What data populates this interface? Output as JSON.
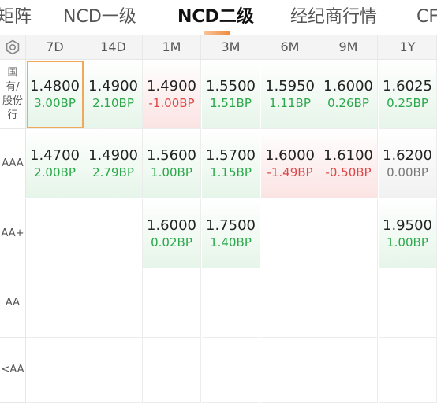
{
  "tabs": [
    {
      "label": "矩阵"
    },
    {
      "label": "NCD一级"
    },
    {
      "label": "NCD二级"
    },
    {
      "label": "经纪商行情"
    },
    {
      "label": "CF"
    }
  ],
  "columns": [
    "7D",
    "14D",
    "1M",
    "3M",
    "6M",
    "9M",
    "1Y"
  ],
  "rows": [
    {
      "label_lines": [
        "国",
        "有/",
        "股份",
        "行"
      ],
      "cells": [
        {
          "rate": "1.4800",
          "bp": "3.00BP",
          "trend": "up",
          "selected": true
        },
        {
          "rate": "1.4900",
          "bp": "2.10BP",
          "trend": "up"
        },
        {
          "rate": "1.4900",
          "bp": "-1.00BP",
          "trend": "down"
        },
        {
          "rate": "1.5500",
          "bp": "1.51BP",
          "trend": "up"
        },
        {
          "rate": "1.5950",
          "bp": "1.11BP",
          "trend": "up"
        },
        {
          "rate": "1.6000",
          "bp": "0.26BP",
          "trend": "up"
        },
        {
          "rate": "1.6025",
          "bp": "0.25BP",
          "trend": "up"
        }
      ]
    },
    {
      "label_lines": [
        "AAA"
      ],
      "cells": [
        {
          "rate": "1.4700",
          "bp": "2.00BP",
          "trend": "up"
        },
        {
          "rate": "1.4900",
          "bp": "2.79BP",
          "trend": "up"
        },
        {
          "rate": "1.5600",
          "bp": "1.00BP",
          "trend": "up"
        },
        {
          "rate": "1.5700",
          "bp": "1.15BP",
          "trend": "up"
        },
        {
          "rate": "1.6000",
          "bp": "-1.49BP",
          "trend": "down"
        },
        {
          "rate": "1.6100",
          "bp": "-0.50BP",
          "trend": "down"
        },
        {
          "rate": "1.6200",
          "bp": "0.00BP",
          "trend": "flat"
        }
      ]
    },
    {
      "label_lines": [
        "AA+"
      ],
      "cells": [
        {
          "rate": "",
          "bp": "",
          "trend": "empty"
        },
        {
          "rate": "",
          "bp": "",
          "trend": "empty"
        },
        {
          "rate": "1.6000",
          "bp": "0.02BP",
          "trend": "up"
        },
        {
          "rate": "1.7500",
          "bp": "1.40BP",
          "trend": "up"
        },
        {
          "rate": "",
          "bp": "",
          "trend": "empty"
        },
        {
          "rate": "",
          "bp": "",
          "trend": "empty"
        },
        {
          "rate": "1.9500",
          "bp": "1.00BP",
          "trend": "up"
        }
      ]
    },
    {
      "label_lines": [
        "AA"
      ],
      "cells": [
        {
          "rate": "",
          "bp": "",
          "trend": "empty"
        },
        {
          "rate": "",
          "bp": "",
          "trend": "empty"
        },
        {
          "rate": "",
          "bp": "",
          "trend": "empty"
        },
        {
          "rate": "",
          "bp": "",
          "trend": "empty"
        },
        {
          "rate": "",
          "bp": "",
          "trend": "empty"
        },
        {
          "rate": "",
          "bp": "",
          "trend": "empty"
        },
        {
          "rate": "",
          "bp": "",
          "trend": "empty"
        }
      ]
    },
    {
      "label_lines": [
        "<AA"
      ],
      "cells": [
        {
          "rate": "",
          "bp": "",
          "trend": "empty"
        },
        {
          "rate": "",
          "bp": "",
          "trend": "empty"
        },
        {
          "rate": "",
          "bp": "",
          "trend": "empty"
        },
        {
          "rate": "",
          "bp": "",
          "trend": "empty"
        },
        {
          "rate": "",
          "bp": "",
          "trend": "empty"
        },
        {
          "rate": "",
          "bp": "",
          "trend": "empty"
        },
        {
          "rate": "",
          "bp": "",
          "trend": "empty"
        }
      ]
    }
  ],
  "icons": {
    "settings": "settings-icon"
  },
  "colors": {
    "accent": "#f08a3c",
    "up": "#2aa84a",
    "down": "#e04646",
    "flat": "#777777"
  }
}
